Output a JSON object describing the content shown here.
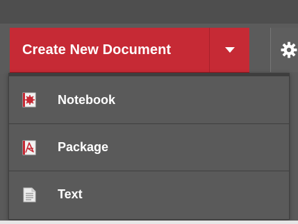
{
  "toolbar": {
    "create_label": "Create New Document",
    "dropdown_caret": "chevron-down-icon",
    "settings_icon": "gear-icon",
    "accent_color": "#c62a35"
  },
  "menu": {
    "items": [
      {
        "label": "Notebook",
        "icon": "notebook-icon"
      },
      {
        "label": "Package",
        "icon": "package-icon"
      },
      {
        "label": "Text",
        "icon": "text-file-icon"
      }
    ]
  }
}
